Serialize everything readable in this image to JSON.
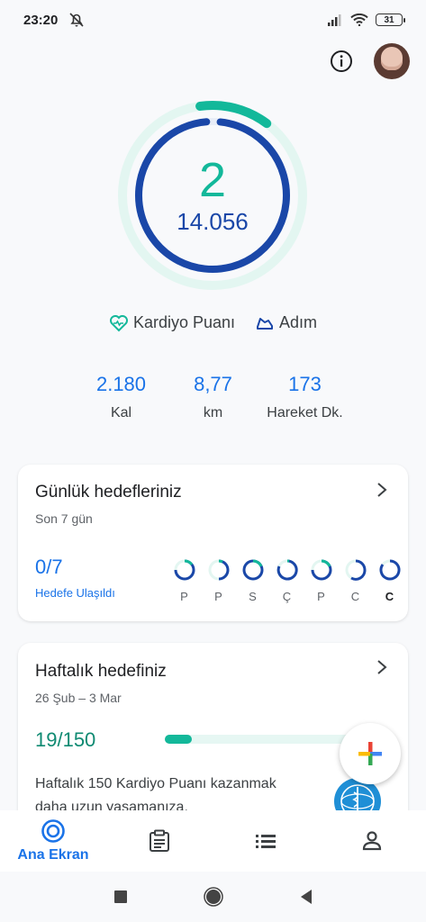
{
  "status_bar": {
    "time": "23:20",
    "battery": "31",
    "icons": [
      "mute-alarm-icon",
      "signal-icon",
      "wifi-icon",
      "battery-icon"
    ]
  },
  "header": {
    "info_icon": "info-icon",
    "avatar": "profile-avatar"
  },
  "rings": {
    "heart_points": "2",
    "steps": "14.056",
    "heart_goal_fraction": 0.125,
    "steps_goal_fraction": 0.97,
    "colors": {
      "heart": "#13b89a",
      "steps": "#1a47a8",
      "heart_track": "#e3f6f1"
    }
  },
  "legend": {
    "heart_label": "Kardiyo Puanı",
    "steps_label": "Adım"
  },
  "metrics": [
    {
      "value": "2.180",
      "label": "Kal"
    },
    {
      "value": "8,77",
      "label": "km"
    },
    {
      "value": "173",
      "label": "Hareket Dk."
    }
  ],
  "daily_goals": {
    "title": "Günlük hedefleriniz",
    "subtitle": "Son 7 gün",
    "count": "0/7",
    "link": "Hedefe Ulaşıldı",
    "days": [
      {
        "label": "P",
        "today": false
      },
      {
        "label": "P",
        "today": false
      },
      {
        "label": "S",
        "today": false
      },
      {
        "label": "Ç",
        "today": false
      },
      {
        "label": "P",
        "today": false
      },
      {
        "label": "C",
        "today": false
      },
      {
        "label": "C",
        "today": true
      }
    ]
  },
  "weekly_goal": {
    "title": "Haftalık hedefiniz",
    "date_range": "26 Şub – 3 Mar",
    "count": "19/150",
    "progress_fraction": 0.13,
    "description": "Haftalık 150 Kardiyo Puanı kazanmak daha uzun yaşamanıza,"
  },
  "fab": {
    "icon": "add-icon"
  },
  "bottom_nav": {
    "home_label": "Ana Ekran",
    "items": [
      "home-icon",
      "journal-icon",
      "browse-icon",
      "profile-icon"
    ]
  }
}
